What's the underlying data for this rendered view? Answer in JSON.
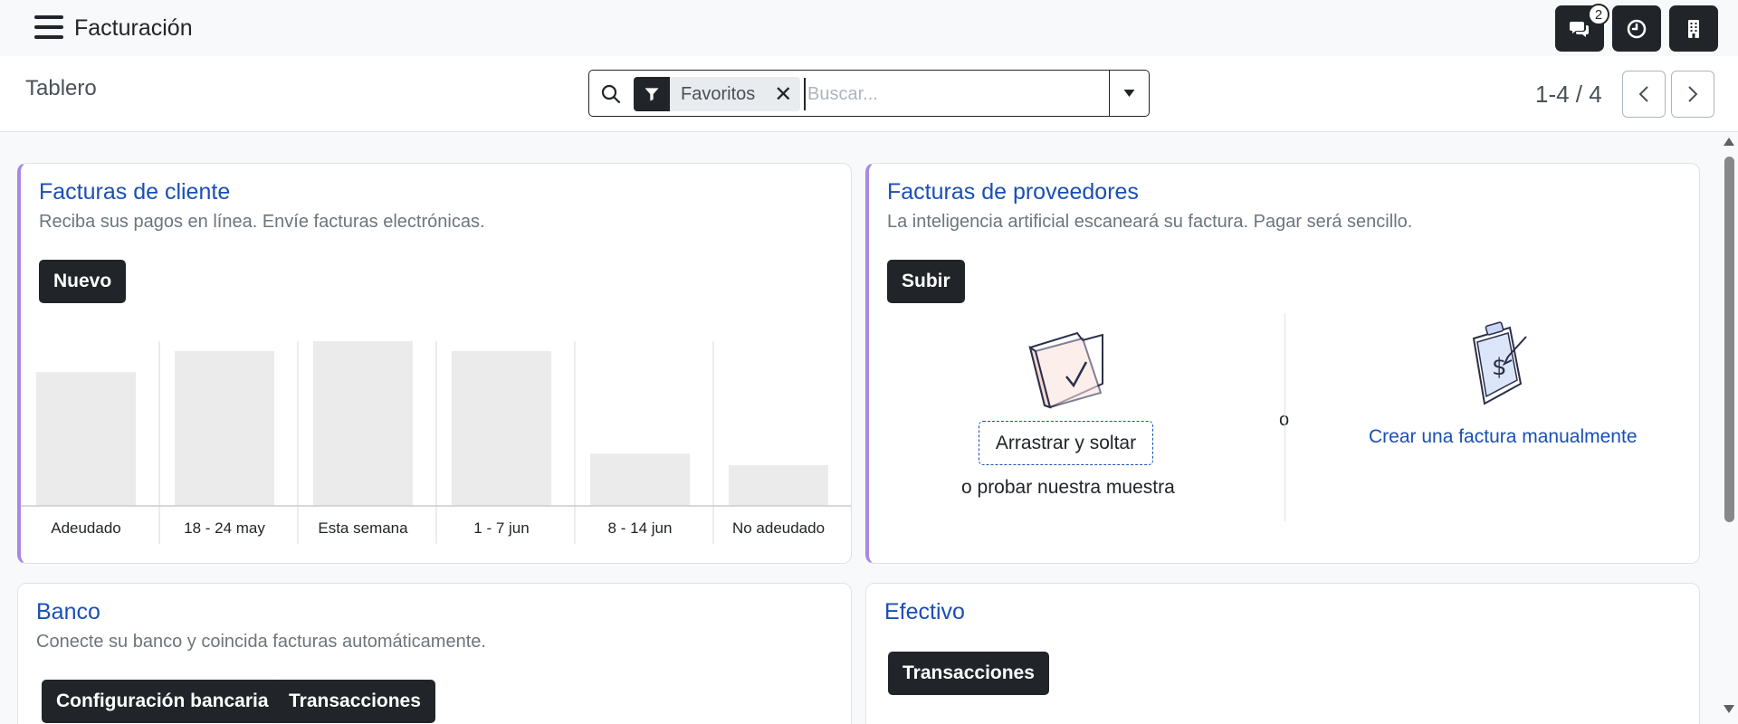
{
  "navbar": {
    "app_title": "Facturación",
    "messages_badge": "2"
  },
  "control_panel": {
    "breadcrumb": "Tablero",
    "search": {
      "facet_label": "Favoritos",
      "placeholder": "Buscar..."
    },
    "pager": {
      "value": "1-4 / 4"
    }
  },
  "cards": {
    "customer_invoices": {
      "title": "Facturas de cliente",
      "subtitle": "Reciba sus pagos en línea. Envíe facturas electrónicas.",
      "button": "Nuevo"
    },
    "vendor_bills": {
      "title": "Facturas de proveedores",
      "subtitle": "La inteligencia artificial escaneará su factura. Pagar será sencillo.",
      "button": "Subir",
      "drop_label": "Arrastrar y soltar",
      "or": "o",
      "sample": "o probar nuestra muestra",
      "manual_link": "Crear una factura manualmente"
    },
    "bank": {
      "title": "Banco",
      "subtitle": "Conecte su banco y coincida facturas automáticamente.",
      "button_config": "Configuración bancaria",
      "button_transactions": "Transacciones"
    },
    "cash": {
      "title": "Efectivo",
      "button_transactions": "Transacciones"
    }
  },
  "chart_data": {
    "type": "bar",
    "categories": [
      "Adeudado",
      "18 - 24 may",
      "Esta semana",
      "1 - 7 jun",
      "8 - 14 jun",
      "No adeudado"
    ],
    "values": [
      82,
      95,
      101,
      95,
      32,
      25
    ],
    "ylim": [
      0,
      101
    ],
    "grid": true,
    "colors": {
      "bar": "#ebebeb",
      "grid": "#d9d9d9",
      "axis": "#cccccc"
    }
  }
}
